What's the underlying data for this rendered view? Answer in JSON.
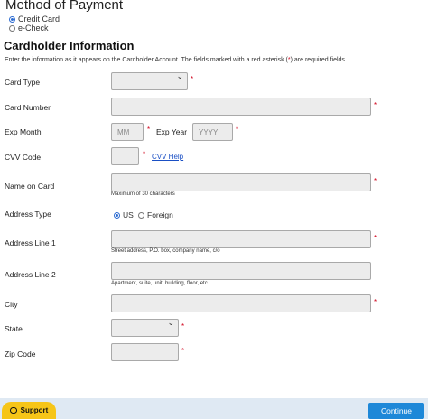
{
  "payment": {
    "title": "Method of Payment",
    "options": [
      {
        "label": "Credit Card",
        "selected": true
      },
      {
        "label": "e-Check",
        "selected": false
      }
    ]
  },
  "cardholder": {
    "title": "Cardholder Information",
    "instructions_pre": "Enter the information as it appears on the Cardholder Account. The fields marked with a red asterisk (",
    "asterisk": "*",
    "instructions_post": ") are required fields."
  },
  "fields": {
    "card_type": {
      "label": "Card Type",
      "value": ""
    },
    "card_number": {
      "label": "Card Number",
      "value": ""
    },
    "exp_month": {
      "label": "Exp Month",
      "placeholder": "MM"
    },
    "exp_year": {
      "label": "Exp Year",
      "placeholder": "YYYY"
    },
    "cvv": {
      "label": "CVV Code",
      "value": "",
      "help_link": "CVV Help"
    },
    "name_on_card": {
      "label": "Name on Card",
      "value": "",
      "hint": "Maximum of 30 characters"
    },
    "address_type": {
      "label": "Address Type",
      "options": [
        {
          "label": "US",
          "selected": true
        },
        {
          "label": "Foreign",
          "selected": false
        }
      ]
    },
    "address1": {
      "label": "Address Line 1",
      "value": "",
      "hint": "Street address, P.O. box, company name, c/o"
    },
    "address2": {
      "label": "Address Line 2",
      "value": "",
      "hint": "Apartment, suite, unit, building, floor, etc."
    },
    "city": {
      "label": "City",
      "value": ""
    },
    "state": {
      "label": "State",
      "value": ""
    },
    "zip": {
      "label": "Zip Code",
      "value": ""
    }
  },
  "required_marker": "*",
  "footer": {
    "support_label": "Support",
    "continue_label": "Continue"
  },
  "colors": {
    "accent": "#1e88d8",
    "required": "#d0021b",
    "support": "#f6c518",
    "footer_bg": "#dfe9f3"
  }
}
